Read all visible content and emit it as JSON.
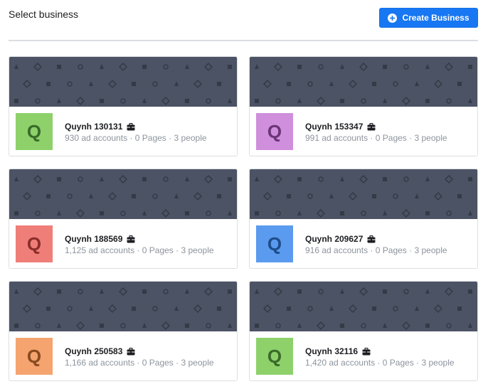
{
  "header": {
    "title": "Select business",
    "create_button_label": "Create Business",
    "create_button_icon": "plus-circle-icon",
    "accent": "#1877f2"
  },
  "banner": {
    "color": "#4b5364",
    "pattern_color": "#343b47"
  },
  "businesses": [
    {
      "name": "Quynh 130131",
      "initial": "Q",
      "ad_accounts": "930 ad accounts",
      "pages": "0 Pages",
      "people": "3 people",
      "avatar_bg": "#8ed16b",
      "avatar_fg": "#3a6b2a",
      "badge_icon": "briefcase-icon"
    },
    {
      "name": "Quynh 153347",
      "initial": "Q",
      "ad_accounts": "991 ad accounts",
      "pages": "0 Pages",
      "people": "3 people",
      "avatar_bg": "#cf8fdc",
      "avatar_fg": "#6b3478",
      "badge_icon": "briefcase-icon"
    },
    {
      "name": "Quynh 188569",
      "initial": "Q",
      "ad_accounts": "1,125 ad accounts",
      "pages": "0 Pages",
      "people": "3 people",
      "avatar_bg": "#f07e78",
      "avatar_fg": "#8a2e29",
      "badge_icon": "briefcase-icon"
    },
    {
      "name": "Quynh 209627",
      "initial": "Q",
      "ad_accounts": "916 ad accounts",
      "pages": "0 Pages",
      "people": "3 people",
      "avatar_bg": "#5a9bef",
      "avatar_fg": "#1e4d8a",
      "badge_icon": "briefcase-icon"
    },
    {
      "name": "Quynh 250583",
      "initial": "Q",
      "ad_accounts": "1,166 ad accounts",
      "pages": "0 Pages",
      "people": "3 people",
      "avatar_bg": "#f5a46f",
      "avatar_fg": "#8a4a1f",
      "badge_icon": "briefcase-icon"
    },
    {
      "name": "Quynh 32116",
      "initial": "Q",
      "ad_accounts": "1,420 ad accounts",
      "pages": "0 Pages",
      "people": "3 people",
      "avatar_bg": "#8ed16b",
      "avatar_fg": "#3a6b2a",
      "badge_icon": "briefcase-icon"
    }
  ]
}
